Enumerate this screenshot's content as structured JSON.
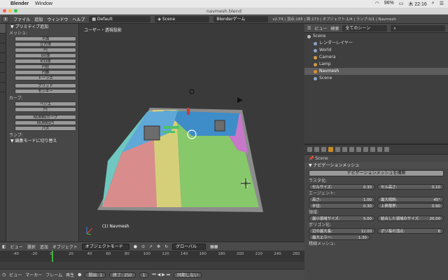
{
  "mac_menu": {
    "apple": "",
    "app": "Blender",
    "window": "Window",
    "battery": "96%",
    "clock": "木 22:16"
  },
  "window_title": "navmesh.blend",
  "info_header": {
    "menus": [
      "ファイル",
      "追加",
      "ウィンドウ",
      "ヘルプ"
    ],
    "screen": "Default",
    "scene": "Scene",
    "engine": "Blenderゲーム",
    "stats": "v2.74 | 頂点:185 | 面:173 | オブジェクト:1/4 | ランプ:0/1 | Navmesh"
  },
  "tool_shelf": {
    "tabs": [
      "ツール",
      "作成",
      "関係",
      "アニメ",
      "物理",
      "グリース",
      "ペンシル"
    ],
    "primitive_header": "▼ プリミティブ追加",
    "mesh_label": "メッシュ:",
    "mesh_buttons": [
      "平面",
      "立方体",
      "円",
      "UV球",
      "ICO球",
      "円柱",
      "円錐",
      "トーラス"
    ],
    "grid": "グリッド",
    "monkey": "モンキー",
    "curve_label": "カーブ:",
    "curve_buttons": [
      "ベジエ",
      "円",
      "NURBSカーブ",
      "NURBS円",
      "パス"
    ],
    "lamp_label": "ランプ:",
    "mode_header": "▼ 編集モードに切り替え"
  },
  "viewport": {
    "header": "ユーザー・透視投影",
    "object_label": "(1) Navmesh"
  },
  "outliner": {
    "view": "ビュー",
    "search": "検索",
    "filter": "全てのシーン",
    "rows": [
      {
        "label": "Scene",
        "indent": 0,
        "color": "#bbbbbb",
        "selected": false
      },
      {
        "label": "レンダーレイヤー",
        "indent": 1,
        "color": "#8da3c7",
        "selected": false
      },
      {
        "label": "World",
        "indent": 1,
        "color": "#8da3c7",
        "selected": false
      },
      {
        "label": "Camera",
        "indent": 1,
        "color": "#d19a4a",
        "selected": false
      },
      {
        "label": "Lamp",
        "indent": 1,
        "color": "#d19a4a",
        "selected": false
      },
      {
        "label": "Navmesh",
        "indent": 1,
        "color": "#e88d2a",
        "selected": true
      },
      {
        "label": "Scene",
        "indent": 1,
        "color": "#8da3c7",
        "selected": false
      }
    ]
  },
  "properties": {
    "context": "Scene",
    "panel": "▼ ナビゲーションメッシュ",
    "build_button": "ナビゲーションメッシュを構築",
    "raster": "ラスタ化:",
    "cell_size": {
      "label": "セルサイズ:",
      "value": "0.30"
    },
    "cell_height": {
      "label": "セル高さ:",
      "value": "0.10"
    },
    "agent": "エージェント:",
    "height": {
      "label": "高さ:",
      "value": "1.00"
    },
    "max_slope": {
      "label": "最大傾斜:",
      "value": "45°"
    },
    "radius": {
      "label": "半径:",
      "value": "0.30"
    },
    "max_climb": {
      "label": "上昇限界:",
      "value": "0.90"
    },
    "region": "領域:",
    "min_region": {
      "label": "最小領域サイズ:",
      "value": "5.00"
    },
    "merged_region": {
      "label": "結合した領域のサイズ:",
      "value": "20.00"
    },
    "polygon": "ポリゴン化:",
    "max_edge": {
      "label": "辺の最大長:",
      "value": "12.00"
    },
    "verts_per_poly": {
      "label": "ポリ毎の頂点:",
      "value": "6"
    },
    "max_error": {
      "label": "最大エラー:",
      "value": "1.30"
    },
    "detail": "精細メッシュ:"
  },
  "view3d_header": {
    "menus": [
      "ビュー",
      "選択",
      "追加",
      "オブジェクト"
    ],
    "mode": "オブジェクトモード",
    "orientation": "グローバル"
  },
  "timeline": {
    "ruler": [
      "-40",
      "-20",
      "0",
      "20",
      "40",
      "60",
      "80",
      "100",
      "120",
      "140",
      "160",
      "180",
      "200",
      "220",
      "240",
      "260"
    ],
    "current_frame_fraction": 0.17,
    "menus": [
      "ビュー",
      "マーカー",
      "フレーム",
      "再生"
    ],
    "start": {
      "label": "開始:",
      "value": "1"
    },
    "end": {
      "label": "終了:",
      "value": "250"
    },
    "current": "1",
    "sync": "同期しない"
  }
}
